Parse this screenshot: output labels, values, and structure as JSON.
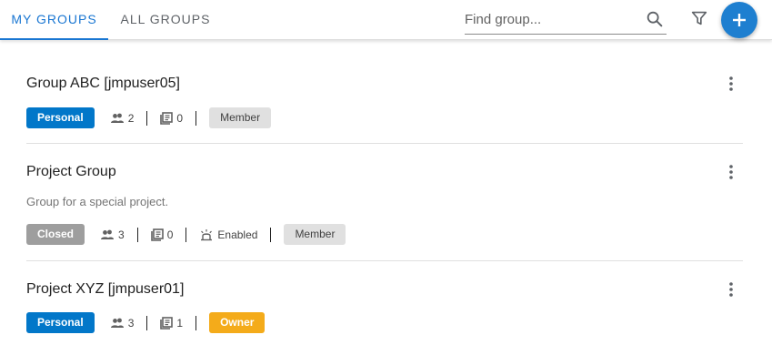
{
  "tabs": [
    {
      "label": "MY GROUPS",
      "active": true
    },
    {
      "label": "ALL GROUPS",
      "active": false
    }
  ],
  "search": {
    "placeholder": "Find group...",
    "value": ""
  },
  "icons": {
    "search": "search-icon",
    "filter": "filter-icon",
    "add": "plus-icon",
    "more": "more-vert-icon",
    "members": "people-icon",
    "annotations": "document-list-icon",
    "notifications": "alarm-light-icon"
  },
  "colors": {
    "accent": "#1976d2",
    "personal": "#0277c9",
    "closed": "#9e9e9e",
    "owner": "#f4ab1a",
    "member": "#e0e0e0"
  },
  "groups": [
    {
      "name": "Group ABC [jmpuser05]",
      "description": "",
      "type": "Personal",
      "members": "2",
      "annotations": "0",
      "notifications": "",
      "role": "Member"
    },
    {
      "name": "Project Group",
      "description": "Group for a special project.",
      "type": "Closed",
      "members": "3",
      "annotations": "0",
      "notifications": "Enabled",
      "role": "Member"
    },
    {
      "name": "Project XYZ [jmpuser01]",
      "description": "",
      "type": "Personal",
      "members": "3",
      "annotations": "1",
      "notifications": "",
      "role": "Owner"
    }
  ]
}
